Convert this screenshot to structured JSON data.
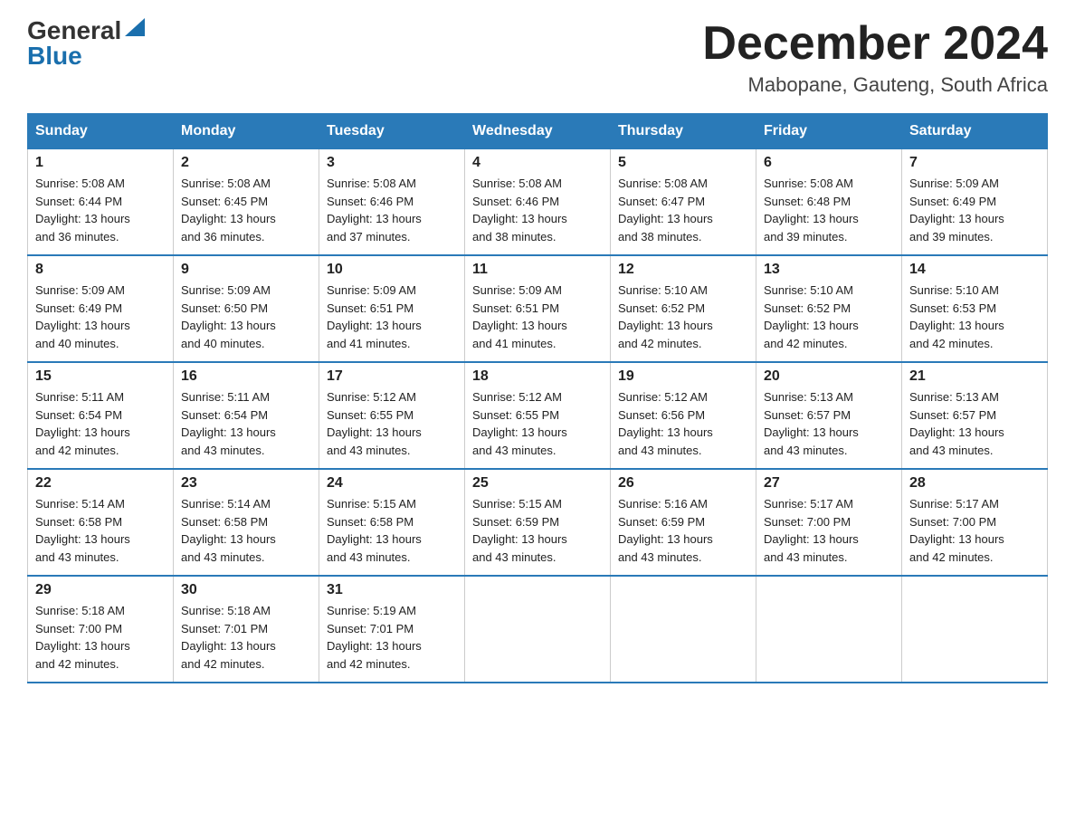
{
  "logo": {
    "general": "General",
    "blue": "Blue"
  },
  "title": "December 2024",
  "subtitle": "Mabopane, Gauteng, South Africa",
  "days_of_week": [
    "Sunday",
    "Monday",
    "Tuesday",
    "Wednesday",
    "Thursday",
    "Friday",
    "Saturday"
  ],
  "weeks": [
    [
      {
        "day": "1",
        "sunrise": "5:08 AM",
        "sunset": "6:44 PM",
        "daylight": "13 hours and 36 minutes."
      },
      {
        "day": "2",
        "sunrise": "5:08 AM",
        "sunset": "6:45 PM",
        "daylight": "13 hours and 36 minutes."
      },
      {
        "day": "3",
        "sunrise": "5:08 AM",
        "sunset": "6:46 PM",
        "daylight": "13 hours and 37 minutes."
      },
      {
        "day": "4",
        "sunrise": "5:08 AM",
        "sunset": "6:46 PM",
        "daylight": "13 hours and 38 minutes."
      },
      {
        "day": "5",
        "sunrise": "5:08 AM",
        "sunset": "6:47 PM",
        "daylight": "13 hours and 38 minutes."
      },
      {
        "day": "6",
        "sunrise": "5:08 AM",
        "sunset": "6:48 PM",
        "daylight": "13 hours and 39 minutes."
      },
      {
        "day": "7",
        "sunrise": "5:09 AM",
        "sunset": "6:49 PM",
        "daylight": "13 hours and 39 minutes."
      }
    ],
    [
      {
        "day": "8",
        "sunrise": "5:09 AM",
        "sunset": "6:49 PM",
        "daylight": "13 hours and 40 minutes."
      },
      {
        "day": "9",
        "sunrise": "5:09 AM",
        "sunset": "6:50 PM",
        "daylight": "13 hours and 40 minutes."
      },
      {
        "day": "10",
        "sunrise": "5:09 AM",
        "sunset": "6:51 PM",
        "daylight": "13 hours and 41 minutes."
      },
      {
        "day": "11",
        "sunrise": "5:09 AM",
        "sunset": "6:51 PM",
        "daylight": "13 hours and 41 minutes."
      },
      {
        "day": "12",
        "sunrise": "5:10 AM",
        "sunset": "6:52 PM",
        "daylight": "13 hours and 42 minutes."
      },
      {
        "day": "13",
        "sunrise": "5:10 AM",
        "sunset": "6:52 PM",
        "daylight": "13 hours and 42 minutes."
      },
      {
        "day": "14",
        "sunrise": "5:10 AM",
        "sunset": "6:53 PM",
        "daylight": "13 hours and 42 minutes."
      }
    ],
    [
      {
        "day": "15",
        "sunrise": "5:11 AM",
        "sunset": "6:54 PM",
        "daylight": "13 hours and 42 minutes."
      },
      {
        "day": "16",
        "sunrise": "5:11 AM",
        "sunset": "6:54 PM",
        "daylight": "13 hours and 43 minutes."
      },
      {
        "day": "17",
        "sunrise": "5:12 AM",
        "sunset": "6:55 PM",
        "daylight": "13 hours and 43 minutes."
      },
      {
        "day": "18",
        "sunrise": "5:12 AM",
        "sunset": "6:55 PM",
        "daylight": "13 hours and 43 minutes."
      },
      {
        "day": "19",
        "sunrise": "5:12 AM",
        "sunset": "6:56 PM",
        "daylight": "13 hours and 43 minutes."
      },
      {
        "day": "20",
        "sunrise": "5:13 AM",
        "sunset": "6:57 PM",
        "daylight": "13 hours and 43 minutes."
      },
      {
        "day": "21",
        "sunrise": "5:13 AM",
        "sunset": "6:57 PM",
        "daylight": "13 hours and 43 minutes."
      }
    ],
    [
      {
        "day": "22",
        "sunrise": "5:14 AM",
        "sunset": "6:58 PM",
        "daylight": "13 hours and 43 minutes."
      },
      {
        "day": "23",
        "sunrise": "5:14 AM",
        "sunset": "6:58 PM",
        "daylight": "13 hours and 43 minutes."
      },
      {
        "day": "24",
        "sunrise": "5:15 AM",
        "sunset": "6:58 PM",
        "daylight": "13 hours and 43 minutes."
      },
      {
        "day": "25",
        "sunrise": "5:15 AM",
        "sunset": "6:59 PM",
        "daylight": "13 hours and 43 minutes."
      },
      {
        "day": "26",
        "sunrise": "5:16 AM",
        "sunset": "6:59 PM",
        "daylight": "13 hours and 43 minutes."
      },
      {
        "day": "27",
        "sunrise": "5:17 AM",
        "sunset": "7:00 PM",
        "daylight": "13 hours and 43 minutes."
      },
      {
        "day": "28",
        "sunrise": "5:17 AM",
        "sunset": "7:00 PM",
        "daylight": "13 hours and 42 minutes."
      }
    ],
    [
      {
        "day": "29",
        "sunrise": "5:18 AM",
        "sunset": "7:00 PM",
        "daylight": "13 hours and 42 minutes."
      },
      {
        "day": "30",
        "sunrise": "5:18 AM",
        "sunset": "7:01 PM",
        "daylight": "13 hours and 42 minutes."
      },
      {
        "day": "31",
        "sunrise": "5:19 AM",
        "sunset": "7:01 PM",
        "daylight": "13 hours and 42 minutes."
      },
      null,
      null,
      null,
      null
    ]
  ],
  "labels": {
    "sunrise": "Sunrise:",
    "sunset": "Sunset:",
    "daylight": "Daylight:"
  }
}
